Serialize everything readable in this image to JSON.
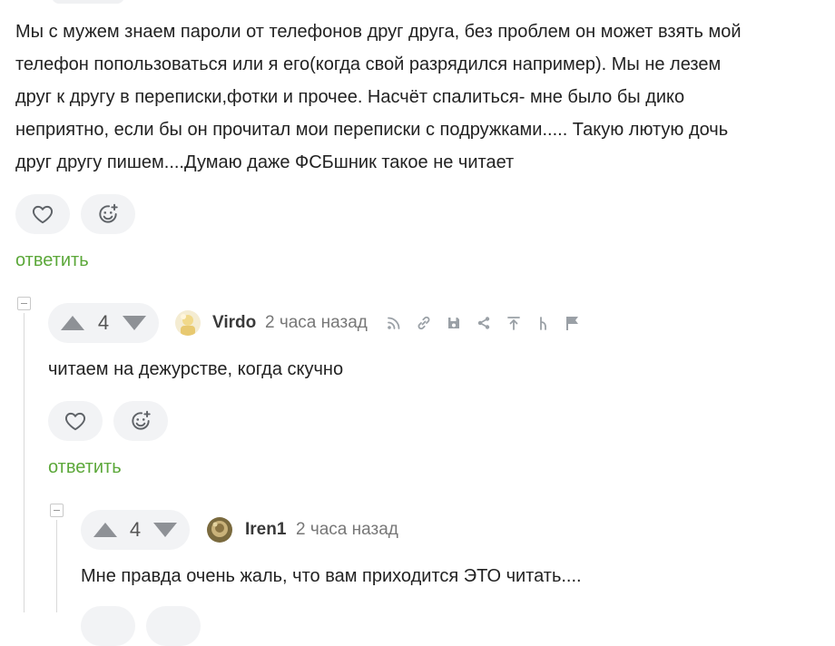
{
  "comments": [
    {
      "text": "Мы с мужем знаем пароли от телефонов друг друга, без проблем он может взять мой телефон попользоваться или я его(когда свой разрядился например). Мы не лезем друг к другу в переписки,фотки и прочее. Насчёт спалиться- мне было бы дико неприятно, если бы он прочитал мои переписки с подружками..... Такую лютую дочь друг другу пишем....Думаю даже ФСБшник такое не читает",
      "text_lines": [
        "Мы с мужем знаем пароли от телефонов друг друга, без проблем он может взять мой",
        "телефон попользоваться или я его(когда свой разрядился например). Мы не лезем",
        "друг к другу в переписки,фотки и прочее. Насчёт спалиться- мне было бы дико",
        "неприятно, если бы он прочитал мои переписки с подружками..... Такую лютую дочь",
        "друг другу пишем....Думаю даже ФСБшник такое не читает"
      ],
      "reply_label": "ответить"
    },
    {
      "rating": "4",
      "username": "Virdo",
      "time": "2 часа назад",
      "text": "читаем на дежурстве, когда скучно",
      "reply_label": "ответить",
      "tool_icons": [
        "rss-icon",
        "link-icon",
        "save-icon",
        "share-icon",
        "scroll-top-icon",
        "branch-icon",
        "flag-icon"
      ]
    },
    {
      "rating": "4",
      "username": "Iren1",
      "time": "2 часа назад",
      "text": "Мне правда очень жаль, что вам приходится ЭТО читать...."
    }
  ],
  "colors": {
    "accent_green": "#5ca83a",
    "button_bg": "#f2f3f5",
    "icon_gray": "#8e9196",
    "text": "#222222"
  }
}
